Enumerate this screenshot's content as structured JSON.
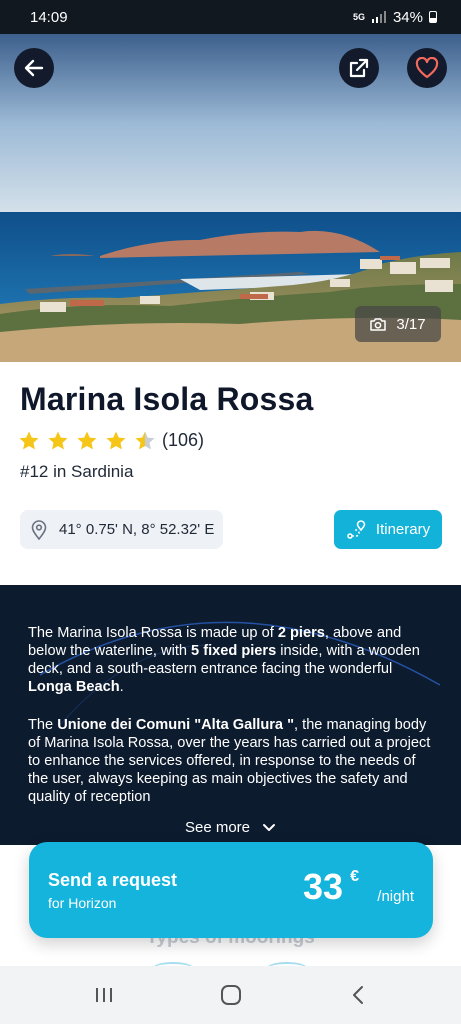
{
  "status_bar": {
    "time": "14:09",
    "network": "5G",
    "battery": "34%"
  },
  "hero": {
    "photo_counter": "3/17",
    "icons": [
      "back-arrow-icon",
      "share-icon",
      "heart-icon",
      "camera-icon"
    ]
  },
  "marina": {
    "name": "Marina Isola Rossa",
    "rating": 4.5,
    "review_count": "(106)",
    "rank": "#12 in Sardinia",
    "coordinates": "41° 0.75' N, 8° 52.32' E",
    "itinerary_label": "Itinerary"
  },
  "description": {
    "p1": [
      {
        "t": "The Marina Isola Rossa is made up of ",
        "b": false
      },
      {
        "t": "2 piers",
        "b": true
      },
      {
        "t": ", above and below the waterline, with ",
        "b": false
      },
      {
        "t": "5 fixed piers",
        "b": true
      },
      {
        "t": " inside, with a wooden deck, and a south-eastern entrance facing the wonderful ",
        "b": false
      },
      {
        "t": "Longa Beach",
        "b": true
      },
      {
        "t": ".",
        "b": false
      }
    ],
    "p2": [
      {
        "t": "The ",
        "b": false
      },
      {
        "t": "Unione dei Comuni \"Alta Gallura \"",
        "b": true
      },
      {
        "t": ", the managing body of Marina Isola Rossa, over the years has carried out a project to enhance the services offered, in response to the needs of the user, always keeping as main objectives the safety and quality of reception",
        "b": false
      }
    ],
    "see_more": "See more"
  },
  "cta": {
    "title": "Send a request",
    "subtitle": "for Horizon",
    "price": "33",
    "currency": "€",
    "unit": "/night"
  },
  "next_section": {
    "title": "Types of moorings"
  },
  "colors": {
    "accent": "#14b4dc",
    "dark": "#0d1b2e",
    "star": "#f5c518"
  }
}
